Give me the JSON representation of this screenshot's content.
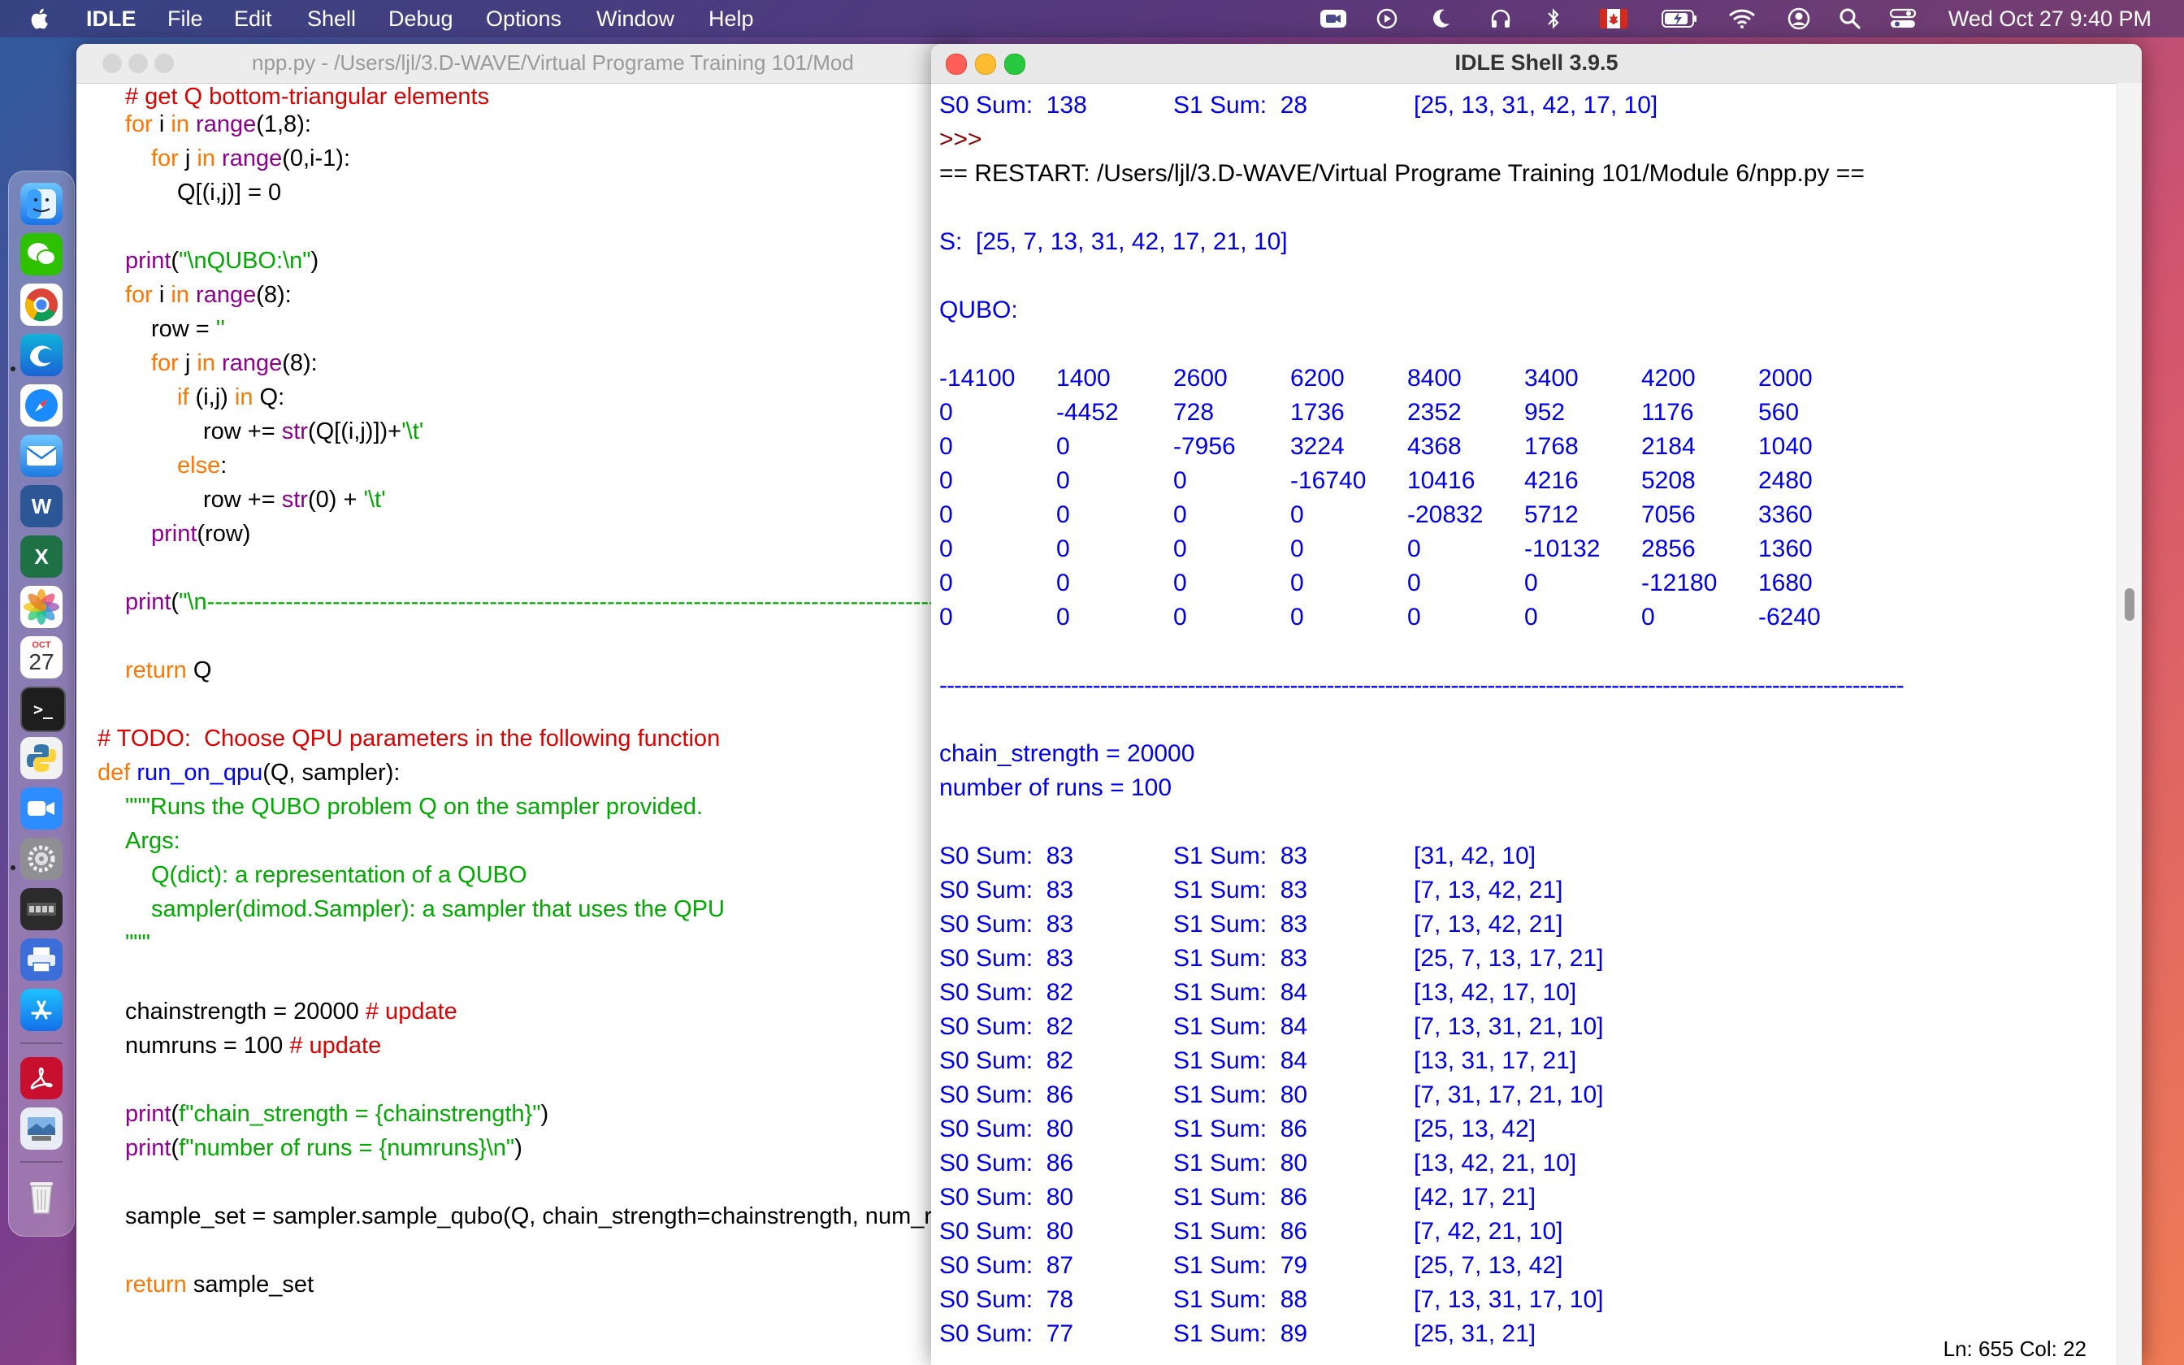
{
  "menubar": {
    "app_name": "IDLE",
    "items": [
      "File",
      "Edit",
      "Shell",
      "Debug",
      "Options",
      "Window",
      "Help"
    ],
    "clock": "Wed Oct 27  9:40 PM"
  },
  "dock": {
    "calendar_month": "OCT",
    "calendar_day": "27"
  },
  "editor": {
    "title": "npp.py - /Users/ljl/3.D-WAVE/Virtual Programe Training 101/Mod"
  },
  "shell": {
    "title": "IDLE Shell 3.9.5",
    "top_sums": {
      "s0": "S0 Sum:  138",
      "s1": "S1 Sum:  28",
      "set": "[25, 13, 31, 42, 17, 10]"
    },
    "prompt": ">>>",
    "restart": "== RESTART: /Users/ljl/3.D-WAVE/Virtual Programe Training 101/Module 6/npp.py ==",
    "s_line": "S:  [25, 7, 13, 31, 42, 17, 21, 10]",
    "qubo_label": "QUBO:",
    "qubo_rows": [
      [
        "-14100",
        "1400",
        "2600",
        "6200",
        "8400",
        "3400",
        "4200",
        "2000"
      ],
      [
        "0",
        "-4452",
        "728",
        "1736",
        "2352",
        "952",
        "1176",
        "560"
      ],
      [
        "0",
        "0",
        "-7956",
        "3224",
        "4368",
        "1768",
        "2184",
        "1040"
      ],
      [
        "0",
        "0",
        "0",
        "-16740",
        "10416",
        "4216",
        "5208",
        "2480"
      ],
      [
        "0",
        "0",
        "0",
        "0",
        "-20832",
        "5712",
        "7056",
        "3360"
      ],
      [
        "0",
        "0",
        "0",
        "0",
        "0",
        "-10132",
        "2856",
        "1360"
      ],
      [
        "0",
        "0",
        "0",
        "0",
        "0",
        "0",
        "-12180",
        "1680"
      ],
      [
        "0",
        "0",
        "0",
        "0",
        "0",
        "0",
        "0",
        "-6240"
      ]
    ],
    "separator": "------------------------------------------------------------------------------------------------------------------------------------",
    "chain_strength": "chain_strength = 20000",
    "num_runs": "number of runs = 100",
    "results": [
      {
        "s0": "S0 Sum:  83",
        "s1": "S1 Sum:  83",
        "set": "[31, 42, 10]"
      },
      {
        "s0": "S0 Sum:  83",
        "s1": "S1 Sum:  83",
        "set": "[7, 13, 42, 21]"
      },
      {
        "s0": "S0 Sum:  83",
        "s1": "S1 Sum:  83",
        "set": "[7, 13, 42, 21]"
      },
      {
        "s0": "S0 Sum:  83",
        "s1": "S1 Sum:  83",
        "set": "[25, 7, 13, 17, 21]"
      },
      {
        "s0": "S0 Sum:  82",
        "s1": "S1 Sum:  84",
        "set": "[13, 42, 17, 10]"
      },
      {
        "s0": "S0 Sum:  82",
        "s1": "S1 Sum:  84",
        "set": "[7, 13, 31, 21, 10]"
      },
      {
        "s0": "S0 Sum:  82",
        "s1": "S1 Sum:  84",
        "set": "[13, 31, 17, 21]"
      },
      {
        "s0": "S0 Sum:  86",
        "s1": "S1 Sum:  80",
        "set": "[7, 31, 17, 21, 10]"
      },
      {
        "s0": "S0 Sum:  80",
        "s1": "S1 Sum:  86",
        "set": "[25, 13, 42]"
      },
      {
        "s0": "S0 Sum:  86",
        "s1": "S1 Sum:  80",
        "set": "[13, 42, 21, 10]"
      },
      {
        "s0": "S0 Sum:  80",
        "s1": "S1 Sum:  86",
        "set": "[42, 17, 21]"
      },
      {
        "s0": "S0 Sum:  80",
        "s1": "S1 Sum:  86",
        "set": "[7, 42, 21, 10]"
      },
      {
        "s0": "S0 Sum:  87",
        "s1": "S1 Sum:  79",
        "set": "[25, 7, 13, 42]"
      },
      {
        "s0": "S0 Sum:  78",
        "s1": "S1 Sum:  88",
        "set": "[7, 13, 31, 17, 10]"
      },
      {
        "s0": "S0 Sum:  77",
        "s1": "S1 Sum:  89",
        "set": "[25, 31, 21]"
      }
    ],
    "status": "Ln: 655   Col: 22"
  }
}
